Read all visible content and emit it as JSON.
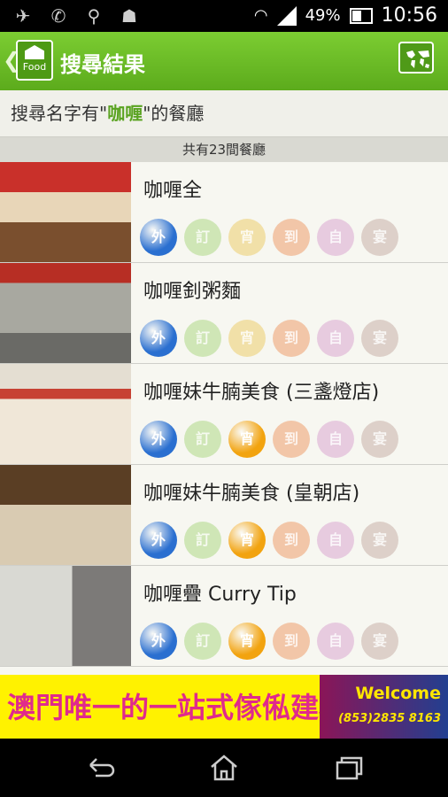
{
  "status": {
    "battery": "49%",
    "time": "10:56"
  },
  "appbar": {
    "back_glyph": "❮",
    "logo_letter": "T",
    "logo_text": "Food",
    "title": "搜尋結果"
  },
  "query": {
    "prefix": "搜尋名字有\"",
    "keyword": "咖喱",
    "suffix": "\"的餐廳"
  },
  "count_text": "共有23間餐廳",
  "tag_colors": {
    "active_blue": "#2a6fd0",
    "active_orange": "#f2a30f"
  },
  "restaurants": [
    {
      "name": "咖喱全",
      "tags": [
        "外",
        "訂",
        "宵",
        "到",
        "自",
        "宴"
      ],
      "active": [
        1,
        0,
        0,
        0,
        0,
        0
      ]
    },
    {
      "name": "咖喱釗粥麵",
      "tags": [
        "外",
        "訂",
        "宵",
        "到",
        "自",
        "宴"
      ],
      "active": [
        1,
        0,
        0,
        0,
        0,
        0
      ]
    },
    {
      "name": "咖喱妹牛腩美食 (三盞燈店)",
      "tags": [
        "外",
        "訂",
        "宵",
        "到",
        "自",
        "宴"
      ],
      "active": [
        1,
        0,
        1,
        0,
        0,
        0
      ]
    },
    {
      "name": "咖喱妹牛腩美食 (皇朝店)",
      "tags": [
        "外",
        "訂",
        "宵",
        "到",
        "自",
        "宴"
      ],
      "active": [
        1,
        0,
        1,
        0,
        0,
        0
      ]
    },
    {
      "name": "咖喱疊 Curry Tip",
      "tags": [
        "外",
        "訂",
        "宵",
        "到",
        "自",
        "宴"
      ],
      "active": [
        1,
        0,
        1,
        0,
        0,
        0
      ]
    }
  ],
  "ad": {
    "text": "澳門唯一的一站式傢俬建材城",
    "welcome": "Welcome",
    "phone": "(853)2835 8163"
  }
}
